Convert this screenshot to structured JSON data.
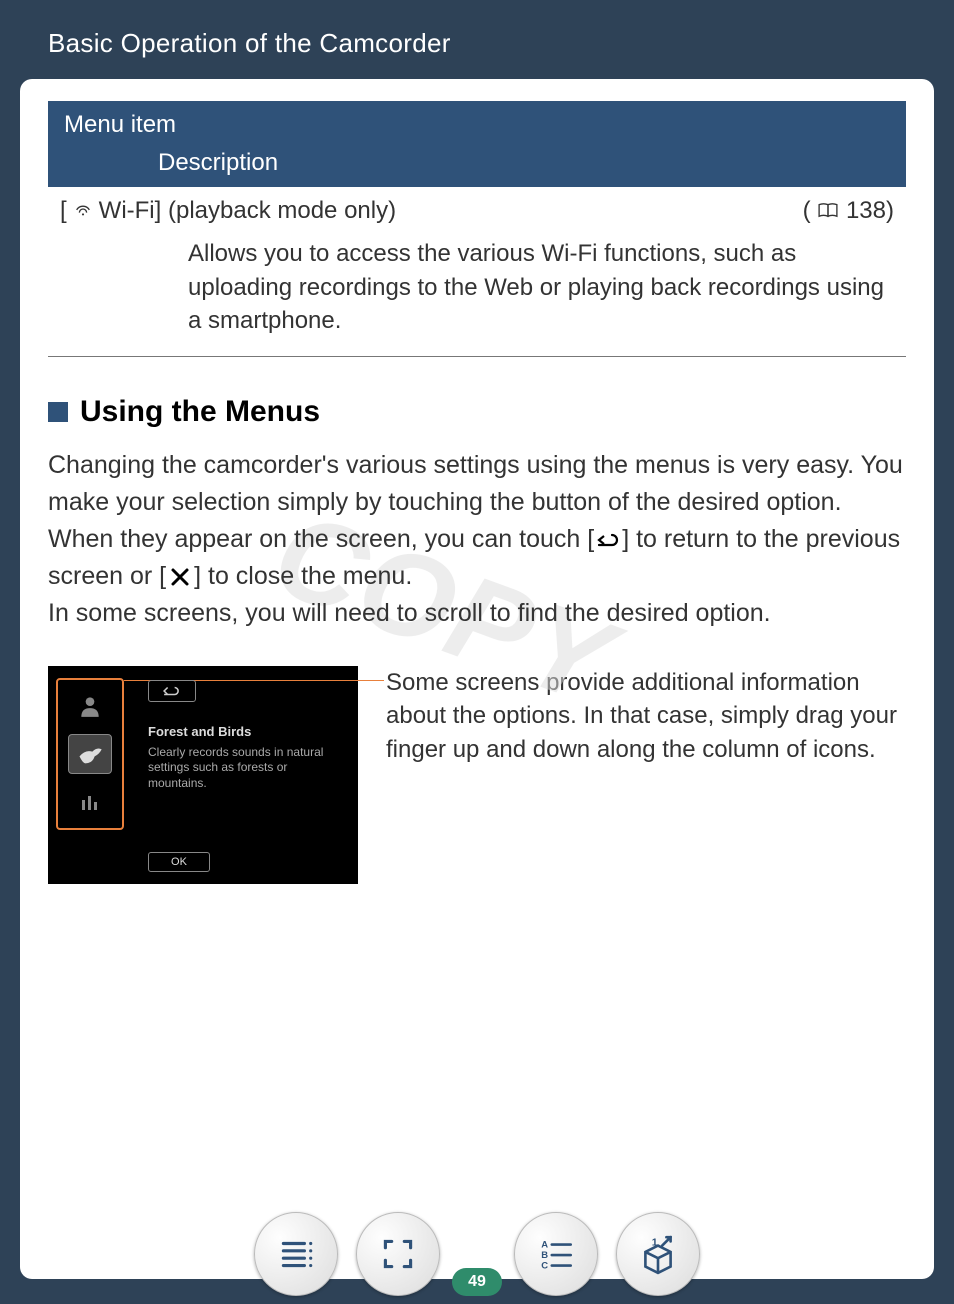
{
  "page_title": "Basic Operation of the Camcorder",
  "watermark": "COPY",
  "table": {
    "header_col1": "Menu item",
    "header_col2": "Description",
    "row": {
      "left_bracket": "[",
      "item_label": " Wi-Fi] (playback mode only)",
      "ref_open": "(",
      "ref_page": " 138)",
      "description": "Allows you to access the various Wi-Fi functions, such as uploading recordings to the Web or playing back recordings using a smartphone."
    }
  },
  "section": {
    "title": "Using the Menus",
    "body_part1": "Changing the camcorder's various settings using the menus is very easy. You make your selection simply by touching the button of the desired option. When they appear on the screen, you can touch [",
    "body_part2": "] to return to the previous screen or [",
    "body_part3": "] to close the menu.",
    "body_part4": "In some screens, you will need to scroll to find the desired option."
  },
  "figure": {
    "caption": "Some screens provide additional information about the options. In that case, simply drag your finger up and down along the column of icons.",
    "screenshot": {
      "title": "Forest and Birds",
      "desc": "Clearly records sounds in natural settings such as forests or mountains.",
      "ok_label": "OK"
    }
  },
  "page_number": "49"
}
